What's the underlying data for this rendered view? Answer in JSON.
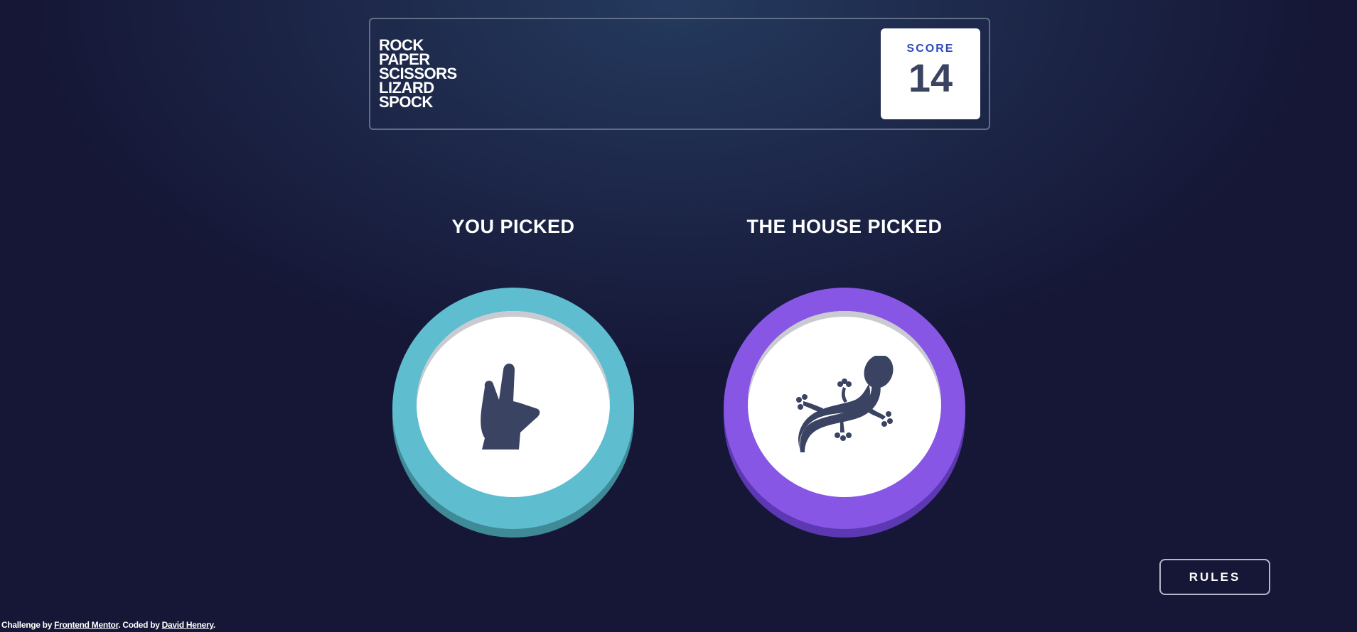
{
  "header": {
    "logo_lines": [
      "ROCK",
      "PAPER",
      "SCISSORS",
      "LIZARD",
      "SPOCK"
    ],
    "score_label": "SCORE",
    "score_value": "14"
  },
  "picks": {
    "you_label": "YOU PICKED",
    "house_label": "THE HOUSE PICKED",
    "you_choice": "spock",
    "house_choice": "lizard"
  },
  "rules_button": "RULES",
  "attribution": {
    "prefix": "Challenge by ",
    "link1": "Frontend Mentor",
    "middle": ". Coded by ",
    "link2": "David Henery",
    "suffix": "."
  },
  "colors": {
    "spock": "#5fbdd0",
    "lizard": "#8856e4",
    "score_label": "#2a46c0",
    "score_value": "#3b4363",
    "icon": "#3b4363"
  }
}
